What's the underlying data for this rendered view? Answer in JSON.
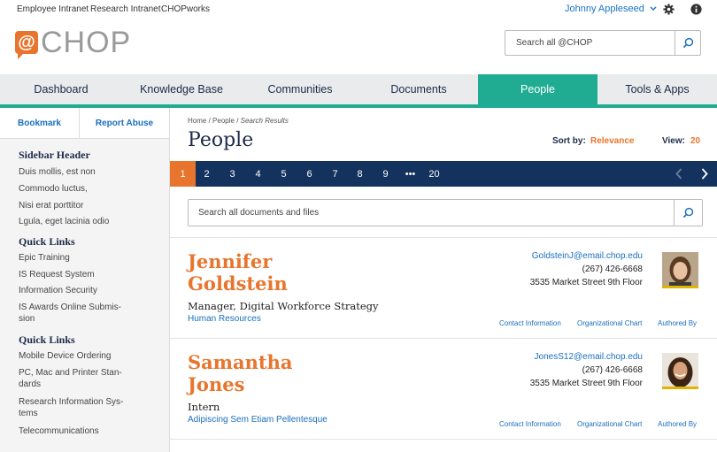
{
  "topbar": {
    "links": [
      "Employee Intranet",
      "Research Intranet",
      "CHOPworks"
    ],
    "user": "Johnny Appleseed",
    "gear_icon": "gear-icon",
    "info_icon": "info-icon"
  },
  "logo": {
    "mark": "@",
    "text": "CHOP"
  },
  "search_top": {
    "placeholder": "Search all @CHOP"
  },
  "nav": {
    "tabs": [
      "Dashboard",
      "Knowledge Base",
      "Communities",
      "Documents",
      "People",
      "Tools & Apps"
    ],
    "active": "People"
  },
  "sidebar": {
    "bookmark": "Bookmark",
    "report": "Report Abuse",
    "sections": [
      {
        "header": "Sidebar Header",
        "items": [
          "Duis mollis, est non",
          "Commodo luctus,",
          "Nisi erat porttitor",
          "Lgula, eget lacinia odio"
        ]
      },
      {
        "header": "Quick Links",
        "items": [
          "Epic Training",
          "IS Request System",
          "Information Security",
          "IS Awards Online Submis-sion"
        ]
      },
      {
        "header": "Quick Links",
        "items": [
          "Mobile Device Ordering",
          "PC, Mac and Printer Stan-dards",
          "Research Information Sys-tems",
          "Telecommunications"
        ]
      }
    ]
  },
  "main": {
    "breadcrumb": [
      "Home",
      "People",
      "Search Results"
    ],
    "title": "People",
    "sort_label": "Sort by:",
    "sort_value": "Relevance",
    "view_label": "View:",
    "view_value": "20",
    "pager": [
      "1",
      "2",
      "3",
      "4",
      "5",
      "6",
      "7",
      "8",
      "9",
      "•••",
      "20"
    ],
    "pager_active": "1",
    "search": {
      "placeholder": "Search all documents and files"
    },
    "people": [
      {
        "name_first": "Jennifer",
        "name_last": "Goldstein",
        "role": "Manager, Digital Workforce Strategy",
        "dept": "Human Resources",
        "email": "GoldsteinJ@email.chop.edu",
        "phone": "(267) 426-6668",
        "address": "3535 Market Street 9th Floor",
        "links": [
          "Contact Information",
          "Organizational Chart",
          "Authored By"
        ]
      },
      {
        "name_first": "Samantha",
        "name_last": "Jones",
        "role": "Intern",
        "dept": "Adipiscing Sem Etiam Pellentesque",
        "email": "JonesS12@email.chop.edu",
        "phone": "(267) 426-6668",
        "address": "3535 Market Street 9th Floor",
        "links": [
          "Contact Information",
          "Organizational Chart",
          "Authored By"
        ]
      }
    ]
  },
  "colors": {
    "accent": "#1fac93",
    "orange": "#e8752d",
    "navy": "#13325e",
    "link": "#1a6fbf"
  }
}
